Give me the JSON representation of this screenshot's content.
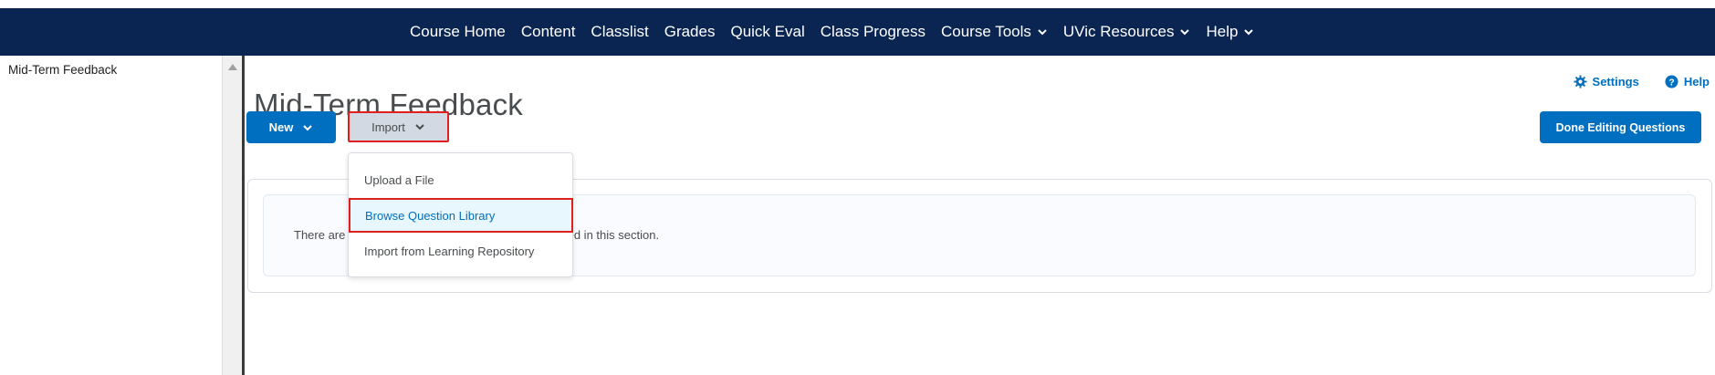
{
  "nav": {
    "items": [
      {
        "label": "Course Home",
        "dropdown": false
      },
      {
        "label": "Content",
        "dropdown": false
      },
      {
        "label": "Classlist",
        "dropdown": false
      },
      {
        "label": "Grades",
        "dropdown": false
      },
      {
        "label": "Quick Eval",
        "dropdown": false
      },
      {
        "label": "Class Progress",
        "dropdown": false
      },
      {
        "label": "Course Tools",
        "dropdown": true
      },
      {
        "label": "UVic Resources",
        "dropdown": true
      },
      {
        "label": "Help",
        "dropdown": true
      }
    ]
  },
  "sidebar": {
    "title": "Mid-Term Feedback"
  },
  "main": {
    "title": "Mid-Term Feedback",
    "settings_label": "Settings",
    "help_label": "Help",
    "new_label": "New",
    "import_label": "Import",
    "done_label": "Done Editing Questions",
    "empty_text_left": "There are",
    "empty_text_right": "ned in this section."
  },
  "import_menu": {
    "items": [
      {
        "label": "Upload a File",
        "selected": false
      },
      {
        "label": "Browse Question Library",
        "selected": true
      },
      {
        "label": "Import from Learning Repository",
        "selected": false
      }
    ]
  },
  "colors": {
    "navbar": "#0b2552",
    "primary": "#006fbf",
    "highlight_border": "#e02020"
  }
}
